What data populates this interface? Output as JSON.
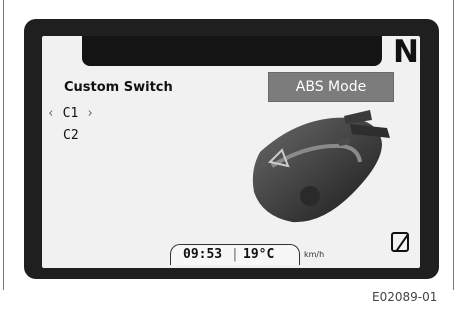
{
  "display": {
    "gear": "N",
    "menu_title": "Custom Switch",
    "mode_button": "ABS Mode",
    "options": [
      {
        "left": "‹",
        "label": "C1",
        "right": "›",
        "selected": true
      },
      {
        "label": "C2",
        "selected": false
      }
    ],
    "status": {
      "time": "09:53",
      "separator": "|",
      "temperature": "19°C",
      "unit": "km/h"
    }
  },
  "caption": "E02089-01"
}
